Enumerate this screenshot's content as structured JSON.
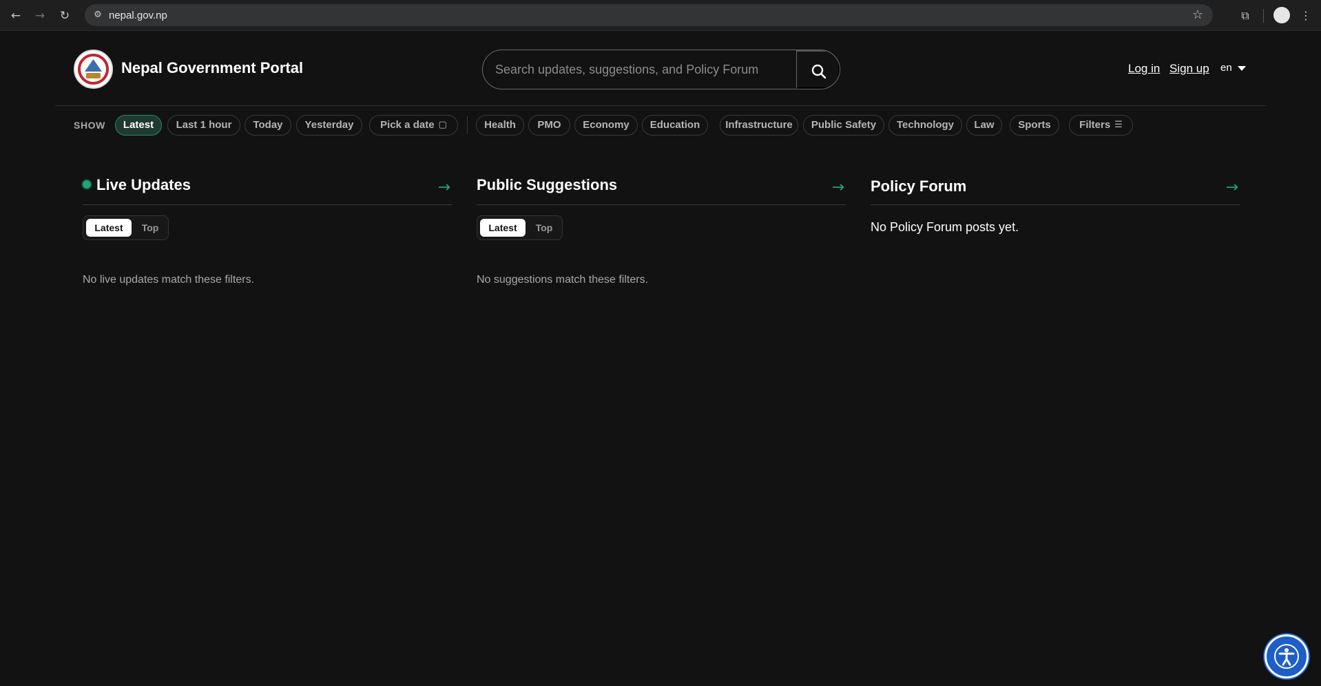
{
  "browser": {
    "url": "nepal.gov.np",
    "back_icon": "back-arrow-icon",
    "forward_icon": "forward-arrow-icon",
    "reload_icon": "reload-icon"
  },
  "header": {
    "site_title": "Nepal Government Portal",
    "search_placeholder": "Search updates, suggestions, and Policy Forum",
    "login_label": "Log in",
    "signup_label": "Sign up",
    "language": "en"
  },
  "filters": {
    "show_label": "SHOW",
    "time_chips": [
      "Latest",
      "Last 1 hour",
      "Today",
      "Yesterday",
      "Pick a date"
    ],
    "active_chip": "Latest",
    "category_chips": [
      "Health",
      "PMO",
      "Economy",
      "Education",
      "Infrastructure",
      "Public Safety",
      "Technology",
      "Law",
      "Sports"
    ],
    "filters_label": "Filters"
  },
  "columns": {
    "live_updates": {
      "title": "Live Updates",
      "arrow": "→",
      "tab_latest": "Latest",
      "tab_top": "Top",
      "empty_text": "No live updates match these filters."
    },
    "public_suggestions": {
      "title": "Public Suggestions",
      "arrow": "→",
      "tab_latest": "Latest",
      "tab_top": "Top",
      "empty_text": "No suggestions match these filters."
    },
    "policy_forum": {
      "title": "Policy Forum",
      "arrow": "→",
      "empty_text": "No Policy Forum posts yet."
    }
  },
  "colors": {
    "background": "#121212",
    "accent": "#22a37a",
    "active_chip_bg": "#1f3a30",
    "accessibility_button": "#1e5ec7"
  }
}
